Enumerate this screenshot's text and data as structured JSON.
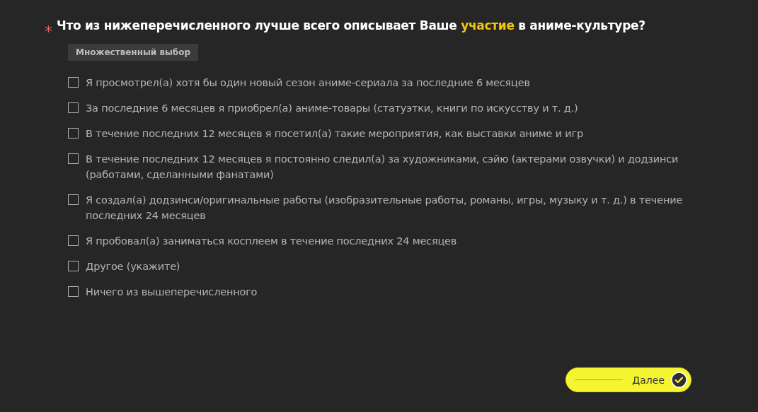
{
  "question": {
    "required_mark": "*",
    "segments": [
      {
        "text": "Что из нижеперечисленного лучше всего описывает Ваше ",
        "highlight": false
      },
      {
        "text": "участие",
        "highlight": true
      },
      {
        "text": " в аниме-культуре?",
        "highlight": false
      }
    ],
    "type_badge": "Множественный выбор"
  },
  "options": [
    {
      "label": "Я просмотрел(а) хотя бы один новый сезон аниме-сериала за последние 6 месяцев",
      "checked": false
    },
    {
      "label": "За последние 6 месяцев я приобрел(а) аниме-товары (статуэтки, книги по искусству и т. д.)",
      "checked": false
    },
    {
      "label": "В течение последних 12 месяцев я посетил(а) такие мероприятия, как выставки аниме и игр",
      "checked": false
    },
    {
      "label": "В течение последних 12 месяцев я постоянно следил(а) за художниками, сэйю (актерами озвучки) и додзинси (работами, сделанными фанатами)",
      "checked": false
    },
    {
      "label": "Я создал(а) додзинси/оригинальные работы (изобразительные работы, романы, игры, музыку и т. д.) в течение последних 24 месяцев",
      "checked": false
    },
    {
      "label": "Я пробовал(а) заниматься косплеем в течение последних 24 месяцев",
      "checked": false
    },
    {
      "label": "Другое (укажите)",
      "checked": false
    },
    {
      "label": "Ничего из вышеперечисленного",
      "checked": false
    }
  ],
  "next_button": {
    "label": "Далее"
  }
}
